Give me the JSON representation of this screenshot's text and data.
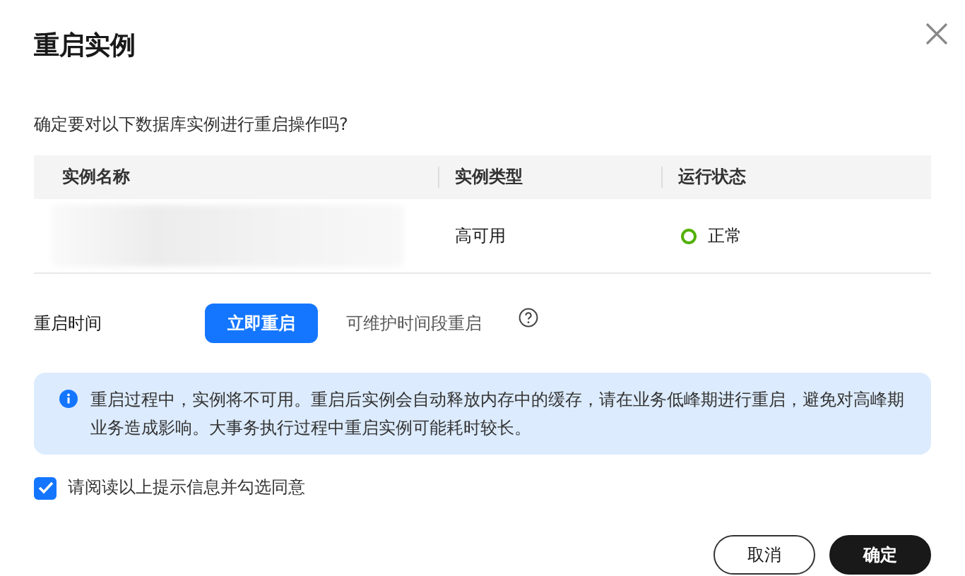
{
  "dialog": {
    "title": "重启实例",
    "question": "确定要对以下数据库实例进行重启操作吗?"
  },
  "table": {
    "columns": [
      "实例名称",
      "实例类型",
      "运行状态"
    ],
    "rows": [
      {
        "name_redacted": true,
        "type": "高可用",
        "status": {
          "text": "正常",
          "color": "#52b000"
        }
      }
    ]
  },
  "restart_time": {
    "label": "重启时间",
    "options": [
      {
        "label": "立即重启",
        "selected": true
      },
      {
        "label": "可维护时间段重启",
        "selected": false
      }
    ]
  },
  "notice": "重启过程中，实例将不可用。重启后实例会自动释放内存中的缓存，请在业务低峰期进行重启，避免对高峰期业务造成影响。大事务执行过程中重启实例可能耗时较长。",
  "agreement": {
    "label": "请阅读以上提示信息并勾选同意",
    "checked": true
  },
  "buttons": [
    {
      "label": "取消",
      "kind": "secondary"
    },
    {
      "label": "确定",
      "kind": "primary"
    }
  ]
}
